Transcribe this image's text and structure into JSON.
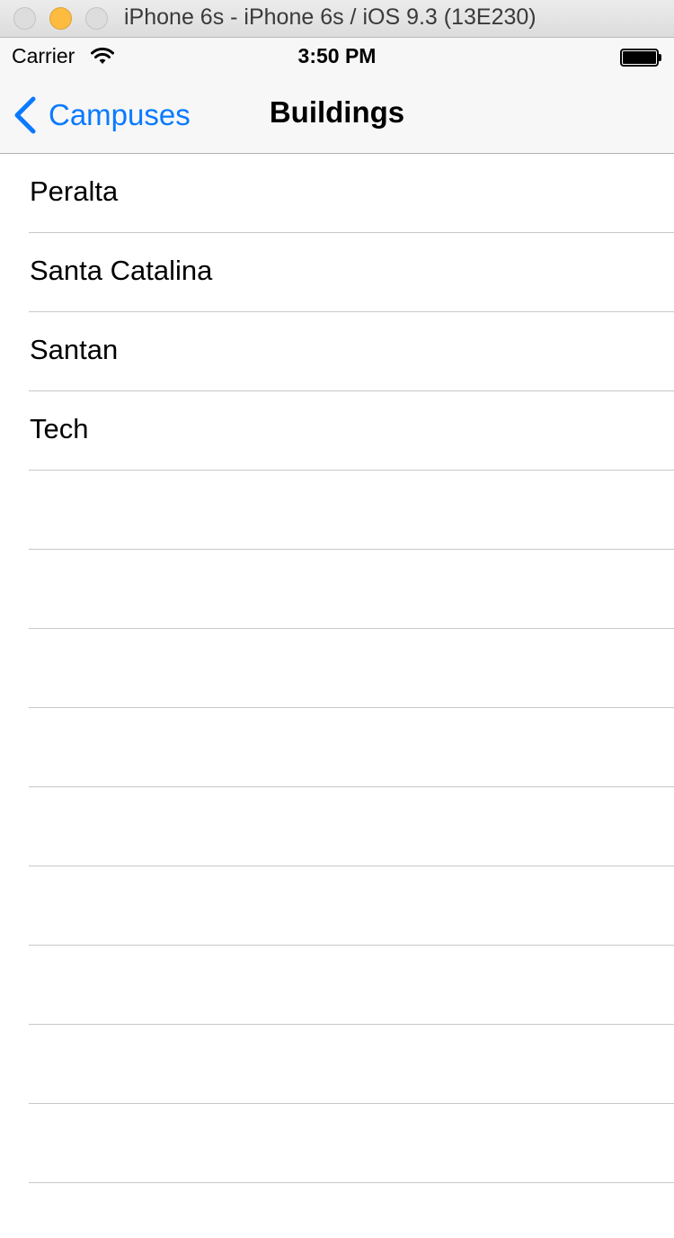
{
  "window": {
    "title": "iPhone 6s - iPhone 6s / iOS 9.3 (13E230)"
  },
  "status_bar": {
    "carrier": "Carrier",
    "time": "3:50 PM",
    "icons": [
      "wifi-icon",
      "battery-icon"
    ]
  },
  "nav_bar": {
    "back_label": "Campuses",
    "title": "Buildings",
    "back_icon": "chevron-left-icon",
    "tint_color": "#0a7aff"
  },
  "table": {
    "rows": [
      {
        "label": "Peralta"
      },
      {
        "label": "Santa Catalina"
      },
      {
        "label": "Santan"
      },
      {
        "label": "Tech"
      },
      {
        "label": ""
      },
      {
        "label": ""
      },
      {
        "label": ""
      },
      {
        "label": ""
      },
      {
        "label": ""
      },
      {
        "label": ""
      },
      {
        "label": ""
      },
      {
        "label": ""
      },
      {
        "label": ""
      }
    ]
  }
}
